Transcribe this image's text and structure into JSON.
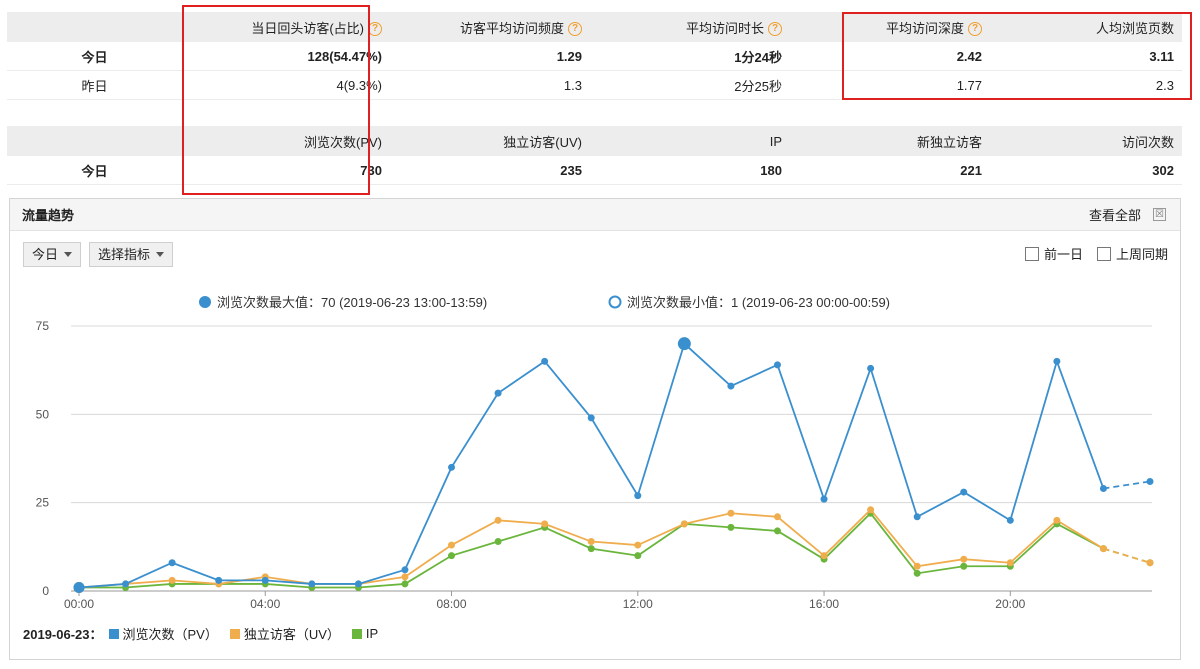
{
  "stats1": {
    "headers": [
      "",
      "当日回头访客(占比)",
      "访客平均访问频度",
      "平均访问时长",
      "平均访问深度",
      "人均浏览页数"
    ],
    "rows": [
      {
        "label": "今日",
        "values": [
          "128(54.47%)",
          "1.29",
          "1分24秒",
          "2.42",
          "3.11"
        ]
      },
      {
        "label": "昨日",
        "values": [
          "4(9.3%)",
          "1.3",
          "2分25秒",
          "1.77",
          "2.3"
        ]
      }
    ]
  },
  "stats2": {
    "headers": [
      "",
      "浏览次数(PV)",
      "独立访客(UV)",
      "IP",
      "新独立访客",
      "访问次数"
    ],
    "rows": [
      {
        "label": "今日",
        "values": [
          "730",
          "235",
          "180",
          "221",
          "302"
        ]
      }
    ]
  },
  "panel": {
    "title": "流量趋势",
    "view_all": "查看全部",
    "close_glyph": "☒",
    "range_select": "今日",
    "metric_select": "选择指标",
    "compare": [
      "前一日",
      "上周同期"
    ]
  },
  "annotations": {
    "max": "浏览次数最大值：70 (2019-06-23 13:00-13:59)",
    "min": "浏览次数最小值：1 (2019-06-23 00:00-00:59)"
  },
  "legend": {
    "date_label": "2019-06-23：",
    "items": [
      "浏览次数（PV）",
      "独立访客（UV）",
      "IP"
    ]
  },
  "colors": {
    "pv": "#3a8fcf",
    "uv": "#f0ad4e",
    "ip": "#6ab53c",
    "grid": "#d8d8d8",
    "highlight": "#e02020"
  },
  "chart_data": {
    "type": "line",
    "x": [
      "00:00",
      "01:00",
      "02:00",
      "03:00",
      "04:00",
      "05:00",
      "06:00",
      "07:00",
      "08:00",
      "09:00",
      "10:00",
      "11:00",
      "12:00",
      "13:00",
      "14:00",
      "15:00",
      "16:00",
      "17:00",
      "18:00",
      "19:00",
      "20:00",
      "21:00",
      "22:00",
      "23:00"
    ],
    "x_tick_labels": [
      "00:00",
      "04:00",
      "08:00",
      "12:00",
      "16:00",
      "20:00"
    ],
    "ylim": [
      0,
      75
    ],
    "y_ticks": [
      0,
      25,
      50,
      75
    ],
    "grid": true,
    "dashed_from_index": 22,
    "series": [
      {
        "name": "浏览次数（PV）",
        "color": "#3a8fcf",
        "values": [
          1,
          2,
          8,
          3,
          3,
          2,
          2,
          6,
          35,
          56,
          65,
          49,
          27,
          70,
          58,
          64,
          26,
          63,
          21,
          28,
          20,
          65,
          29,
          31
        ]
      },
      {
        "name": "独立访客（UV）",
        "color": "#f0ad4e",
        "values": [
          1,
          2,
          3,
          2,
          4,
          2,
          2,
          4,
          13,
          20,
          19,
          14,
          13,
          19,
          22,
          21,
          10,
          23,
          7,
          9,
          8,
          20,
          12,
          8
        ]
      },
      {
        "name": "IP",
        "color": "#6ab53c",
        "values": [
          1,
          1,
          2,
          2,
          2,
          1,
          1,
          2,
          10,
          14,
          18,
          12,
          10,
          19,
          18,
          17,
          9,
          22,
          5,
          7,
          7,
          19,
          12,
          8
        ]
      }
    ],
    "max_point": {
      "index": 13,
      "value": 70
    },
    "min_point": {
      "index": 0,
      "value": 1
    }
  }
}
